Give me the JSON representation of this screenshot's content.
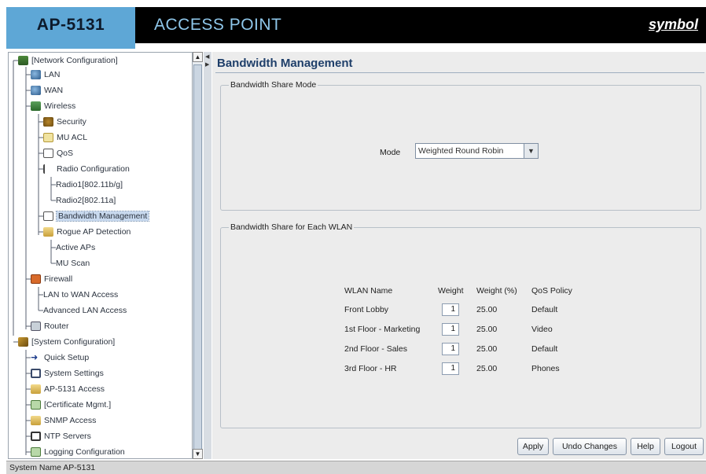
{
  "header": {
    "model": "AP-5131",
    "title": "ACCESS POINT",
    "brand": "symbol"
  },
  "tree": [
    {
      "label": "[Network Configuration]",
      "icon": "network-icon"
    },
    {
      "label": "LAN",
      "icon": "lan-icon"
    },
    {
      "label": "WAN",
      "icon": "wan-icon"
    },
    {
      "label": "Wireless",
      "icon": "wireless-icon"
    },
    {
      "label": "Security",
      "icon": "security-icon"
    },
    {
      "label": "MU ACL",
      "icon": "mu-acl-icon"
    },
    {
      "label": "QoS",
      "icon": "qos-icon"
    },
    {
      "label": "Radio Configuration",
      "icon": "antenna-icon"
    },
    {
      "label": "Radio1[802.11b/g]",
      "icon": ""
    },
    {
      "label": "Radio2[802.11a]",
      "icon": ""
    },
    {
      "label": "Bandwidth Management",
      "icon": "bandwidth-icon"
    },
    {
      "label": "Rogue AP Detection",
      "icon": "rogue-ap-icon"
    },
    {
      "label": "Active APs",
      "icon": ""
    },
    {
      "label": "MU Scan",
      "icon": ""
    },
    {
      "label": "Firewall",
      "icon": "firewall-icon"
    },
    {
      "label": "LAN to WAN Access",
      "icon": ""
    },
    {
      "label": "Advanced LAN Access",
      "icon": ""
    },
    {
      "label": "Router",
      "icon": "router-icon"
    },
    {
      "label": "[System Configuration]",
      "icon": "system-config-icon"
    },
    {
      "label": "Quick Setup",
      "icon": "quick-setup-icon"
    },
    {
      "label": "System Settings",
      "icon": "system-settings-icon"
    },
    {
      "label": "AP-5131 Access",
      "icon": "access-icon"
    },
    {
      "label": "[Certificate Mgmt.]",
      "icon": "certificate-icon"
    },
    {
      "label": "SNMP Access",
      "icon": "snmp-icon"
    },
    {
      "label": "NTP Servers",
      "icon": "clock-icon"
    },
    {
      "label": "Logging Configuration",
      "icon": "logging-icon"
    }
  ],
  "content": {
    "title": "Bandwidth Management",
    "share_mode": {
      "group_title": "Bandwidth Share Mode",
      "mode_label": "Mode",
      "mode_value": "Weighted Round Robin"
    },
    "wlan": {
      "group_title": "Bandwidth Share for Each WLAN",
      "headers": [
        "WLAN Name",
        "Weight",
        "Weight (%)",
        "QoS Policy"
      ],
      "rows": [
        {
          "name": "Front Lobby",
          "weight": "1",
          "percent": "25.00",
          "qos": "Default"
        },
        {
          "name": "1st Floor - Marketing",
          "weight": "1",
          "percent": "25.00",
          "qos": "Video"
        },
        {
          "name": "2nd Floor - Sales",
          "weight": "1",
          "percent": "25.00",
          "qos": "Default"
        },
        {
          "name": "3rd Floor - HR",
          "weight": "1",
          "percent": "25.00",
          "qos": "Phones"
        }
      ]
    },
    "buttons": {
      "apply": "Apply",
      "undo": "Undo Changes",
      "help": "Help",
      "logout": "Logout"
    }
  },
  "status": "System Name AP-5131"
}
